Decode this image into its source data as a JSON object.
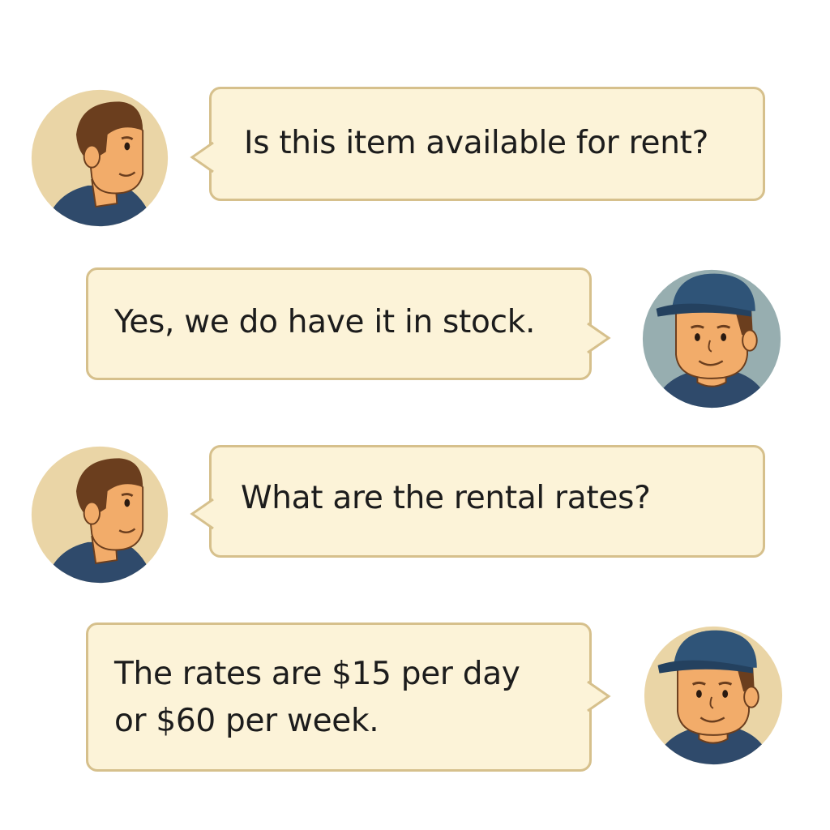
{
  "conversation": {
    "messages": [
      {
        "speaker": "customer",
        "text": "Is this item available for rent?"
      },
      {
        "speaker": "clerk",
        "text": "Yes, we do have it in stock."
      },
      {
        "speaker": "customer",
        "text": "What are the rental rates?"
      },
      {
        "speaker": "clerk",
        "text": "The rates are $15 per day\nor $60 per week."
      }
    ]
  },
  "colors": {
    "bubble_fill": "#fcf3d8",
    "bubble_border": "#d6c08c",
    "customer_avatar_bg": "#ead5a6",
    "clerk_avatar_bg_1": "#97aeb0",
    "clerk_avatar_bg_2": "#ead5a6",
    "skin": "#f2ac6a",
    "hair": "#6b3e1e",
    "shirt": "#2f4a6b",
    "cap": "#2f5478"
  },
  "icons": {
    "customer": "customer-avatar-icon",
    "clerk": "clerk-avatar-icon"
  }
}
